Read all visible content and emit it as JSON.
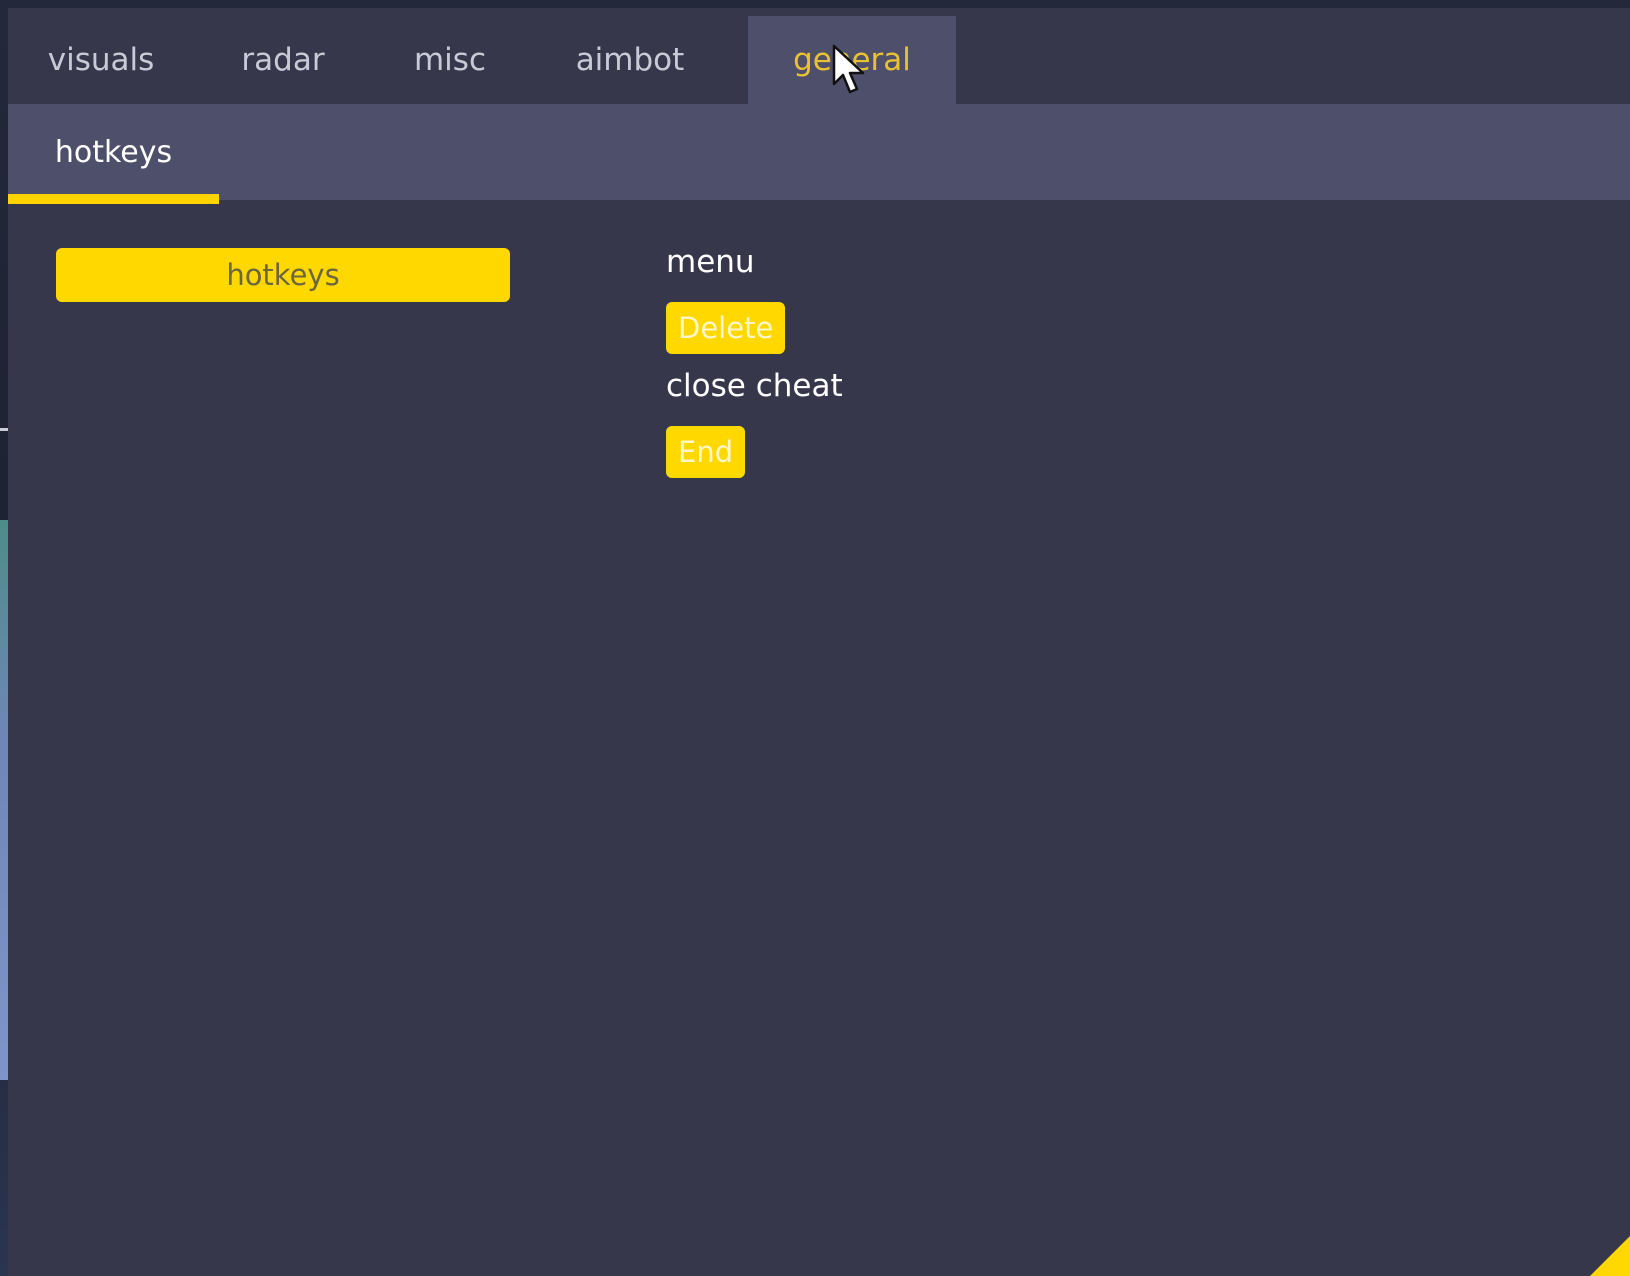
{
  "tabs": [
    {
      "label": "visuals",
      "active": false
    },
    {
      "label": "radar",
      "active": false
    },
    {
      "label": "misc",
      "active": false
    },
    {
      "label": "aimbot",
      "active": false
    },
    {
      "label": "general",
      "active": true
    }
  ],
  "subtabs": [
    {
      "label": "hotkeys",
      "active": true
    }
  ],
  "group": {
    "label": "hotkeys"
  },
  "hotkeys": {
    "menu": {
      "label": "menu",
      "key": "Delete"
    },
    "close_cheat": {
      "label": "close cheat",
      "key": "End"
    }
  },
  "colors": {
    "accent": "#ffd800",
    "panel": "#37374c",
    "tab_active": "#4e4f6a",
    "active_tab_text": "#e8c233"
  },
  "icons": {
    "cursor": "mouse-pointer-icon",
    "resize": "resize-grip-icon"
  }
}
